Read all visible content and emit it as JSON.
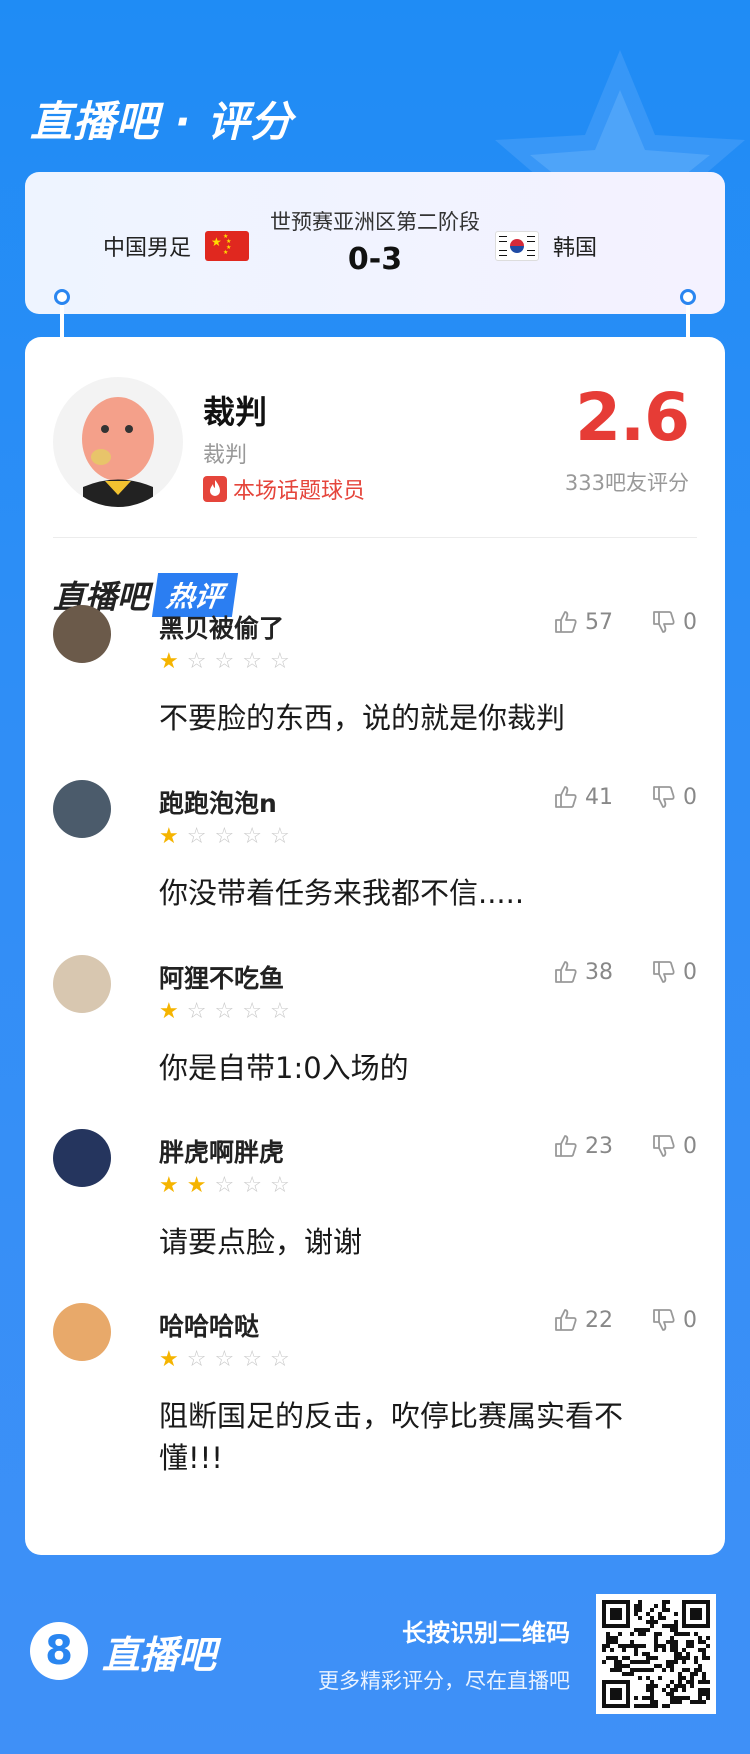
{
  "brand": {
    "title": "直播吧 · 评分"
  },
  "match": {
    "stage": "世预赛亚洲区第二阶段",
    "score": "0-3",
    "home_team": "中国男足",
    "away_team": "韩国"
  },
  "player": {
    "name": "裁判",
    "role": "裁判",
    "tag": "本场话题球员",
    "rating": "2.6",
    "rating_count": "333吧友评分"
  },
  "hot_comments": {
    "brand_label": "直播吧",
    "badge_label": "热评",
    "items": [
      {
        "user": "黑贝被偷了",
        "stars": 1,
        "likes": "57",
        "dislikes": "0",
        "text": "不要脸的东西，说的就是你裁判"
      },
      {
        "user": "跑跑泡泡n",
        "stars": 1,
        "likes": "41",
        "dislikes": "0",
        "text": "你没带着任务来我都不信....."
      },
      {
        "user": "阿狸不吃鱼",
        "stars": 1,
        "likes": "38",
        "dislikes": "0",
        "text": "你是自带1:0入场的"
      },
      {
        "user": "胖虎啊胖虎",
        "stars": 2,
        "likes": "23",
        "dislikes": "0",
        "text": "请要点脸，谢谢"
      },
      {
        "user": "哈哈哈哒",
        "stars": 1,
        "likes": "22",
        "dislikes": "0",
        "text": "阻断国足的反击，吹停比赛属实看不懂!!!"
      }
    ]
  },
  "footer": {
    "logo_text": "直播吧",
    "logo_mark": "8",
    "hint": "长按识别二维码",
    "sub": "更多精彩评分，尽在直播吧"
  },
  "colors": {
    "accent": "#2a86f0",
    "rating": "#e63c36",
    "star_on": "#f5b400",
    "star_off": "#c9c9c9"
  }
}
